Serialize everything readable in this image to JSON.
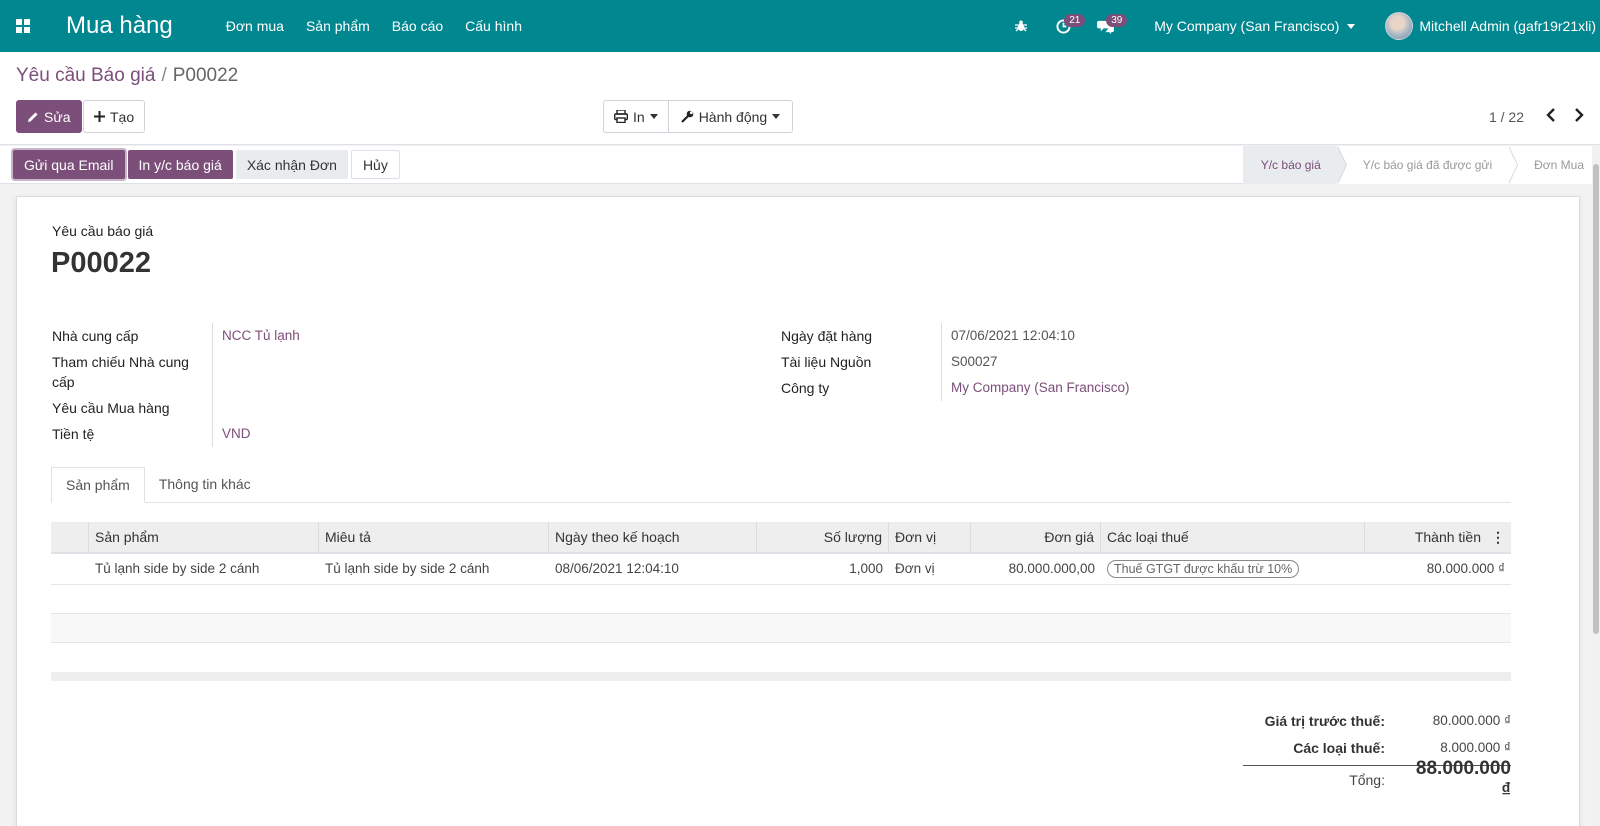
{
  "nav": {
    "app_name": "Mua hàng",
    "menu": [
      "Đơn mua",
      "Sản phẩm",
      "Báo cáo",
      "Cấu hình"
    ],
    "activity_count": "21",
    "message_count": "39",
    "company": "My Company (San Francisco)",
    "user": "Mitchell Admin (gafr19r21xli)"
  },
  "breadcrumb": {
    "parent": "Yêu cầu Báo giá",
    "separator": "/",
    "current": "P00022"
  },
  "buttons": {
    "edit": "Sửa",
    "create": "Tạo",
    "print": "In",
    "action": "Hành động"
  },
  "pager": {
    "value": "1 / 22"
  },
  "statusbar": {
    "actions": [
      "Gửi qua Email",
      "In y/c báo giá",
      "Xác nhận Đơn",
      "Hủy"
    ],
    "stages": [
      "Y/c báo giá",
      "Y/c báo giá đã được gửi",
      "Đơn Mua"
    ],
    "active_stage": "Y/c báo giá"
  },
  "form": {
    "doc_type": "Yêu cầu báo giá",
    "doc_name": "P00022",
    "left": [
      {
        "label": "Nhà cung cấp",
        "value": "NCC Tủ lạnh"
      },
      {
        "label": "Tham chiếu Nhà cung cấp",
        "value": ""
      },
      {
        "label": "Yêu cầu Mua hàng",
        "value": ""
      },
      {
        "label": "Tiền tệ",
        "value": "VND"
      }
    ],
    "right": [
      {
        "label": "Ngày đặt hàng",
        "value": "07/06/2021 12:04:10"
      },
      {
        "label": "Tài liệu Nguồn",
        "value": "S00027"
      },
      {
        "label": "Công ty",
        "value": "My Company (San Francisco)"
      }
    ]
  },
  "tabs": [
    "Sản phẩm",
    "Thông tin khác"
  ],
  "table": {
    "headers": [
      "Sản phẩm",
      "Miêu tả",
      "Ngày theo kế hoạch",
      "Số lượng",
      "Đơn vị",
      "Đơn giá",
      "Các loại thuế",
      "Thành tiền"
    ],
    "rows": [
      {
        "product": "Tủ lạnh side by side 2 cánh",
        "description": "Tủ lạnh side by side 2 cánh",
        "date_planned": "08/06/2021 12:04:10",
        "qty": "1,000",
        "uom": "Đơn vị",
        "price_unit": "80.000.000,00",
        "taxes": "Thuế GTGT được khấu trừ 10%",
        "subtotal": "80.000.000 ₫"
      }
    ]
  },
  "totals": {
    "untaxed_label": "Giá trị trước thuế:",
    "untaxed_value": "80.000.000 ₫",
    "tax_label": "Các loại thuế:",
    "tax_value": "8.000.000 ₫",
    "total_label": "Tổng:",
    "total_value": "88.000.000 ₫"
  },
  "colors": {
    "brand": "#00878f",
    "primary": "#7c4e7a"
  },
  "icons": [
    "apps-icon",
    "bug-icon",
    "clock-icon",
    "chat-icon",
    "pencil-icon",
    "plus-icon",
    "printer-icon",
    "wrench-icon",
    "chevron-left-icon",
    "chevron-right-icon",
    "kebab-icon"
  ]
}
